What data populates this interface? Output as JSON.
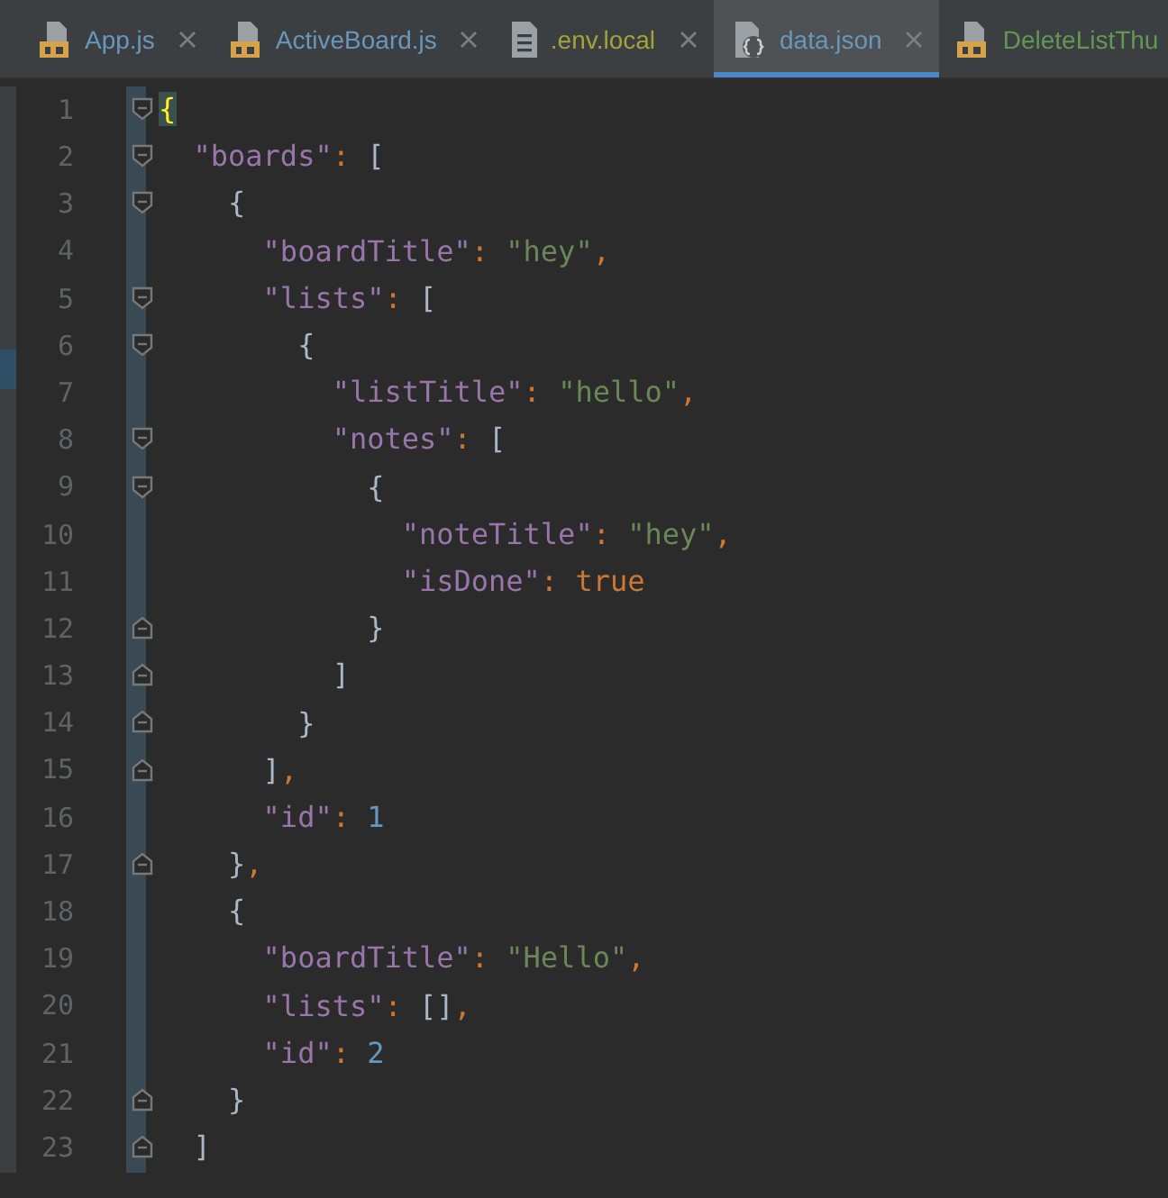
{
  "tabs": [
    {
      "label": "App.js",
      "kind": "js",
      "color": "#6897bb",
      "selected": false,
      "closable": true
    },
    {
      "label": "ActiveBoard.js",
      "kind": "js",
      "color": "#6897bb",
      "selected": false,
      "closable": true
    },
    {
      "label": ".env.local",
      "kind": "text",
      "color": "#a4a339",
      "selected": false,
      "closable": true
    },
    {
      "label": "data.json",
      "kind": "json",
      "color": "#6897bb",
      "selected": true,
      "closable": true
    },
    {
      "label": "DeleteListThu",
      "kind": "js",
      "color": "#629755",
      "selected": false,
      "closable": false
    }
  ],
  "lines": [
    {
      "number": "1",
      "kind": "fold-open",
      "tokens": [
        {
          "kind": "match",
          "text": "{"
        }
      ]
    },
    {
      "number": "2",
      "kind": "fold-open",
      "tokens": [
        {
          "kind": "key",
          "text": "  \"boards\""
        },
        {
          "kind": "op",
          "text": ": "
        },
        {
          "kind": "punct",
          "text": "["
        }
      ]
    },
    {
      "number": "3",
      "kind": "fold-open",
      "tokens": [
        {
          "kind": "punct",
          "text": "    {"
        }
      ]
    },
    {
      "number": "4",
      "kind": "plain",
      "tokens": [
        {
          "kind": "key",
          "text": "      \"boardTitle\""
        },
        {
          "kind": "op",
          "text": ": "
        },
        {
          "kind": "string",
          "text": "\"hey\""
        },
        {
          "kind": "op",
          "text": ","
        }
      ]
    },
    {
      "number": "5",
      "kind": "fold-open",
      "tokens": [
        {
          "kind": "key",
          "text": "      \"lists\""
        },
        {
          "kind": "op",
          "text": ": "
        },
        {
          "kind": "punct",
          "text": "["
        }
      ]
    },
    {
      "number": "6",
      "kind": "fold-open",
      "tokens": [
        {
          "kind": "punct",
          "text": "        {"
        }
      ]
    },
    {
      "number": "7",
      "kind": "plain",
      "tokens": [
        {
          "kind": "key",
          "text": "          \"listTitle\""
        },
        {
          "kind": "op",
          "text": ": "
        },
        {
          "kind": "string",
          "text": "\"hello\""
        },
        {
          "kind": "op",
          "text": ","
        }
      ]
    },
    {
      "number": "8",
      "kind": "fold-open",
      "tokens": [
        {
          "kind": "key",
          "text": "          \"notes\""
        },
        {
          "kind": "op",
          "text": ": "
        },
        {
          "kind": "punct",
          "text": "["
        }
      ]
    },
    {
      "number": "9",
      "kind": "fold-open",
      "tokens": [
        {
          "kind": "punct",
          "text": "            {"
        }
      ]
    },
    {
      "number": "10",
      "kind": "plain",
      "tokens": [
        {
          "kind": "key",
          "text": "              \"noteTitle\""
        },
        {
          "kind": "op",
          "text": ": "
        },
        {
          "kind": "string",
          "text": "\"hey\""
        },
        {
          "kind": "op",
          "text": ","
        }
      ]
    },
    {
      "number": "11",
      "kind": "plain",
      "tokens": [
        {
          "kind": "key",
          "text": "              \"isDone\""
        },
        {
          "kind": "op",
          "text": ": "
        },
        {
          "kind": "keyword",
          "text": "true"
        }
      ]
    },
    {
      "number": "12",
      "kind": "fold-close",
      "tokens": [
        {
          "kind": "punct",
          "text": "            }"
        }
      ]
    },
    {
      "number": "13",
      "kind": "fold-close",
      "tokens": [
        {
          "kind": "punct",
          "text": "          ]"
        }
      ]
    },
    {
      "number": "14",
      "kind": "fold-close",
      "tokens": [
        {
          "kind": "punct",
          "text": "        }"
        }
      ]
    },
    {
      "number": "15",
      "kind": "fold-close",
      "tokens": [
        {
          "kind": "punct",
          "text": "      ]"
        },
        {
          "kind": "op",
          "text": ","
        }
      ]
    },
    {
      "number": "16",
      "kind": "plain",
      "tokens": [
        {
          "kind": "key",
          "text": "      \"id\""
        },
        {
          "kind": "op",
          "text": ": "
        },
        {
          "kind": "number",
          "text": "1"
        }
      ]
    },
    {
      "number": "17",
      "kind": "fold-close",
      "tokens": [
        {
          "kind": "punct",
          "text": "    }"
        },
        {
          "kind": "op",
          "text": ","
        }
      ]
    },
    {
      "number": "18",
      "kind": "plain",
      "tokens": [
        {
          "kind": "punct",
          "text": "    {"
        }
      ]
    },
    {
      "number": "19",
      "kind": "plain",
      "tokens": [
        {
          "kind": "key",
          "text": "      \"boardTitle\""
        },
        {
          "kind": "op",
          "text": ": "
        },
        {
          "kind": "string",
          "text": "\"Hello\""
        },
        {
          "kind": "op",
          "text": ","
        }
      ]
    },
    {
      "number": "20",
      "kind": "plain",
      "tokens": [
        {
          "kind": "key",
          "text": "      \"lists\""
        },
        {
          "kind": "op",
          "text": ": "
        },
        {
          "kind": "punct",
          "text": "[]"
        },
        {
          "kind": "op",
          "text": ","
        }
      ]
    },
    {
      "number": "21",
      "kind": "plain",
      "tokens": [
        {
          "kind": "key",
          "text": "      \"id\""
        },
        {
          "kind": "op",
          "text": ": "
        },
        {
          "kind": "number",
          "text": "2"
        }
      ]
    },
    {
      "number": "22",
      "kind": "fold-close",
      "tokens": [
        {
          "kind": "punct",
          "text": "    }"
        }
      ]
    },
    {
      "number": "23",
      "kind": "fold-close",
      "tokens": [
        {
          "kind": "punct",
          "text": "  ]"
        }
      ]
    }
  ]
}
